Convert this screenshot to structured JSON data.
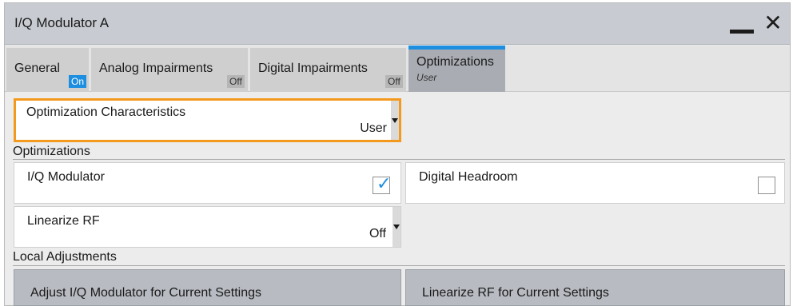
{
  "window": {
    "title": "I/Q Modulator A",
    "close_glyph": "✕"
  },
  "tabs": [
    {
      "label": "General",
      "badge": "On"
    },
    {
      "label": "Analog Impairments",
      "badge": "Off"
    },
    {
      "label": "Digital Impairments",
      "badge": "Off"
    },
    {
      "label": "Optimizations",
      "sub": "User"
    }
  ],
  "optimization_characteristics": {
    "label": "Optimization Characteristics",
    "value": "User"
  },
  "optimizations_section": {
    "label": "Optimizations",
    "iq_modulator": {
      "label": "I/Q Modulator",
      "checked": true,
      "check_glyph": "✓"
    },
    "digital_headroom": {
      "label": "Digital Headroom",
      "checked": false
    },
    "linearize_rf": {
      "label": "Linearize RF",
      "value": "Off"
    }
  },
  "local_adjustments": {
    "label": "Local Adjustments",
    "adjust_button": "Adjust I/Q Modulator for Current Settings",
    "linearize_button": "Linearize RF for Current Settings"
  },
  "colors": {
    "accent": "#1e8fe0",
    "focus": "#f39a1e",
    "titlebar": "#c8ccd2"
  }
}
